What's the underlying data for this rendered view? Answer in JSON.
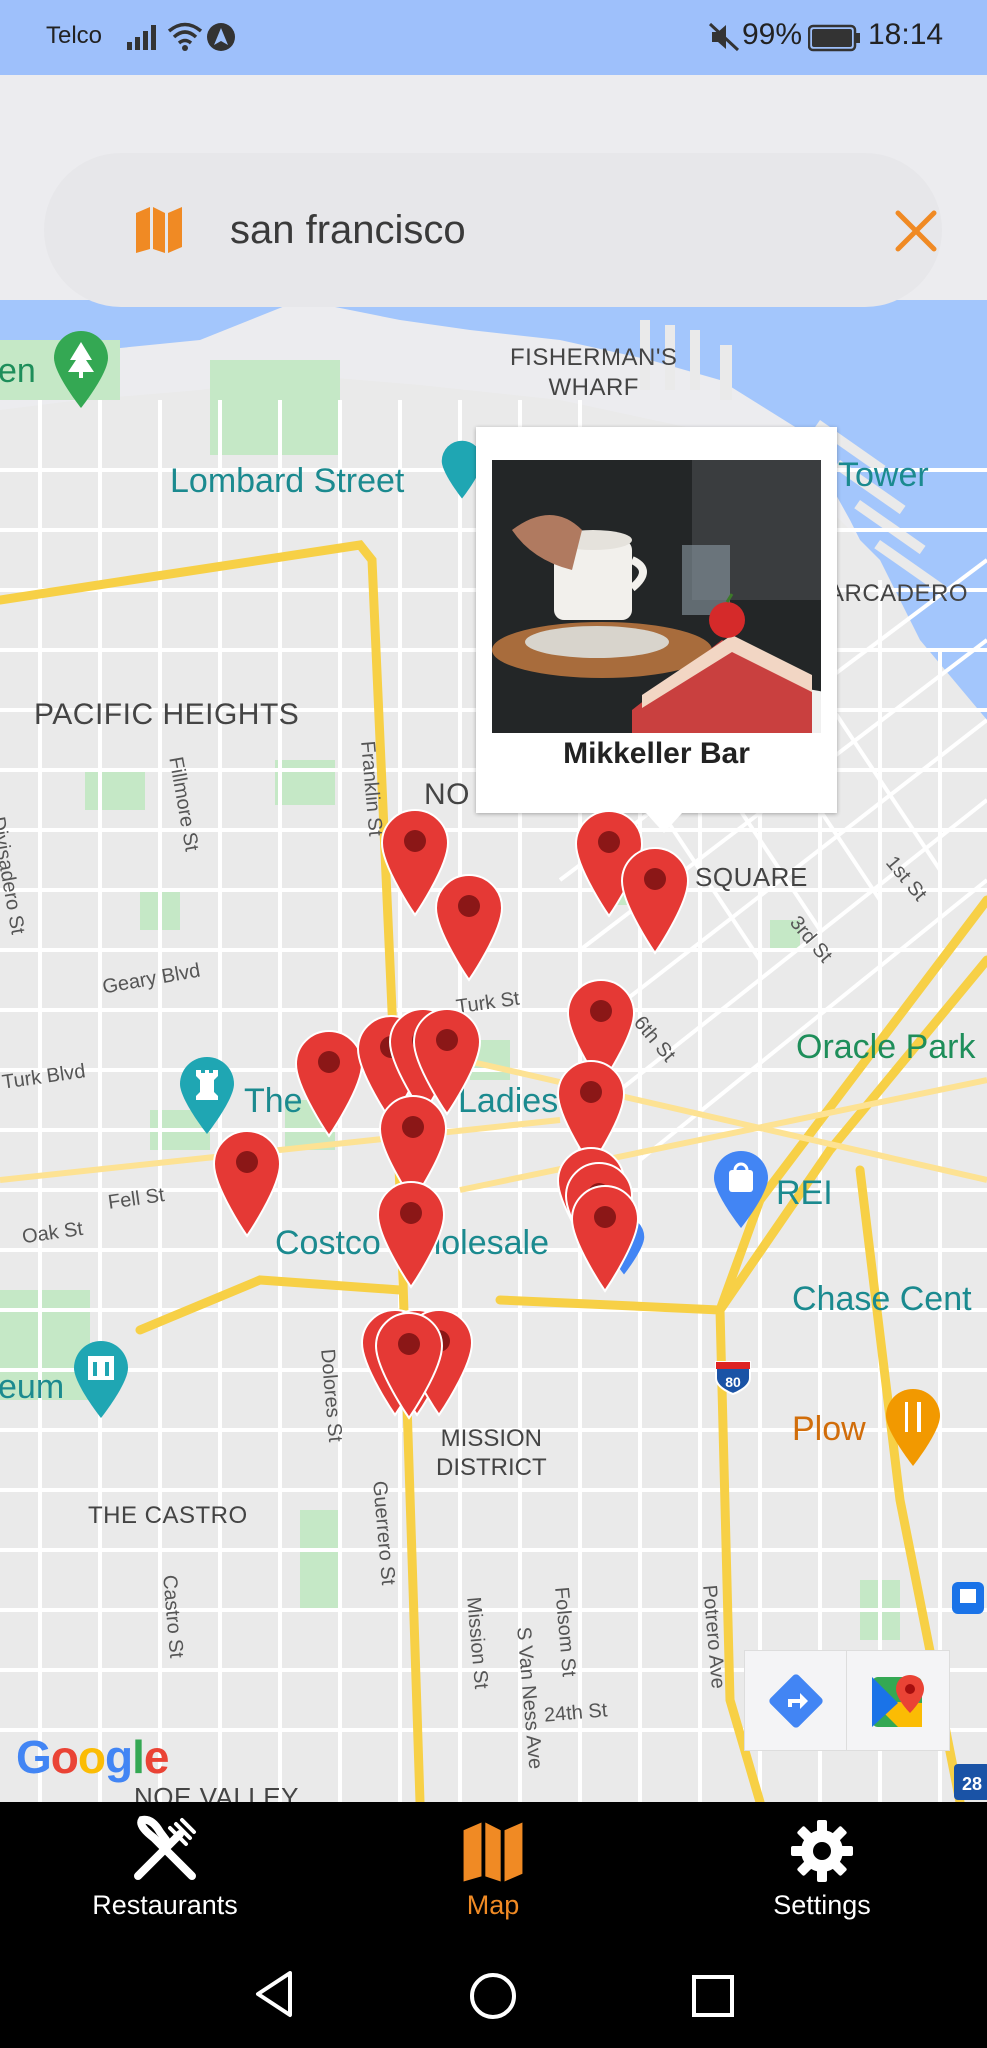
{
  "status_bar": {
    "carrier": "Telco",
    "battery": "99%",
    "time": "18:14"
  },
  "search": {
    "value": "san francisco",
    "map_icon": "map-icon",
    "clear_icon": "close-icon"
  },
  "map": {
    "labels": {
      "fishermans": "FISHERMAN'S\nWHARF",
      "lombard": "Lombard Street",
      "tower": "Tower",
      "embarcadero": "ARCADERO",
      "pacific": "PACIFIC HEIGHTS",
      "nob": "NO",
      "square": "SQUARE",
      "oracle": "Oracle Park",
      "ladies": "The",
      "ladies2": "Ladies",
      "rei": "REI",
      "costco": "Costco Wholesale",
      "chase": "Chase Cent",
      "plow": "Plow",
      "museum": "eum",
      "park_left": "en",
      "mission": "MISSION\nDISTRICT",
      "castro": "THE CASTRO",
      "noe": "NOE VALLEY",
      "divisadero": "Divisadero St",
      "fillmore": "Fillmore St",
      "franklin": "Franklin St",
      "geary": "Geary Blvd",
      "turk": "Turk St",
      "turk_blvd": "Turk Blvd",
      "fell": "Fell St",
      "oak": "Oak St",
      "sixth": "6th St",
      "first": "1st St",
      "third": "3rd St",
      "dolores": "Dolores St",
      "guerrero": "Guerrero St",
      "mission_st": "Mission St",
      "van_ness": "S Van Ness Ave",
      "folsom": "Folsom St",
      "potrero": "Potrero Ave",
      "castro_st": "Castro St",
      "twentyfourth": "24th St",
      "i80": "80",
      "route28": "28"
    },
    "google_logo": "Google"
  },
  "info_window": {
    "title": "Mikkeller Bar"
  },
  "bottom_nav": {
    "items": [
      {
        "label": "Restaurants",
        "icon": "fork-knife-icon",
        "active": false
      },
      {
        "label": "Map",
        "icon": "map-icon",
        "active": true
      },
      {
        "label": "Settings",
        "icon": "gear-icon",
        "active": false
      }
    ]
  },
  "colors": {
    "accent": "#f08a24",
    "pin": "#e53935",
    "status_bg": "#9ec0fb"
  }
}
